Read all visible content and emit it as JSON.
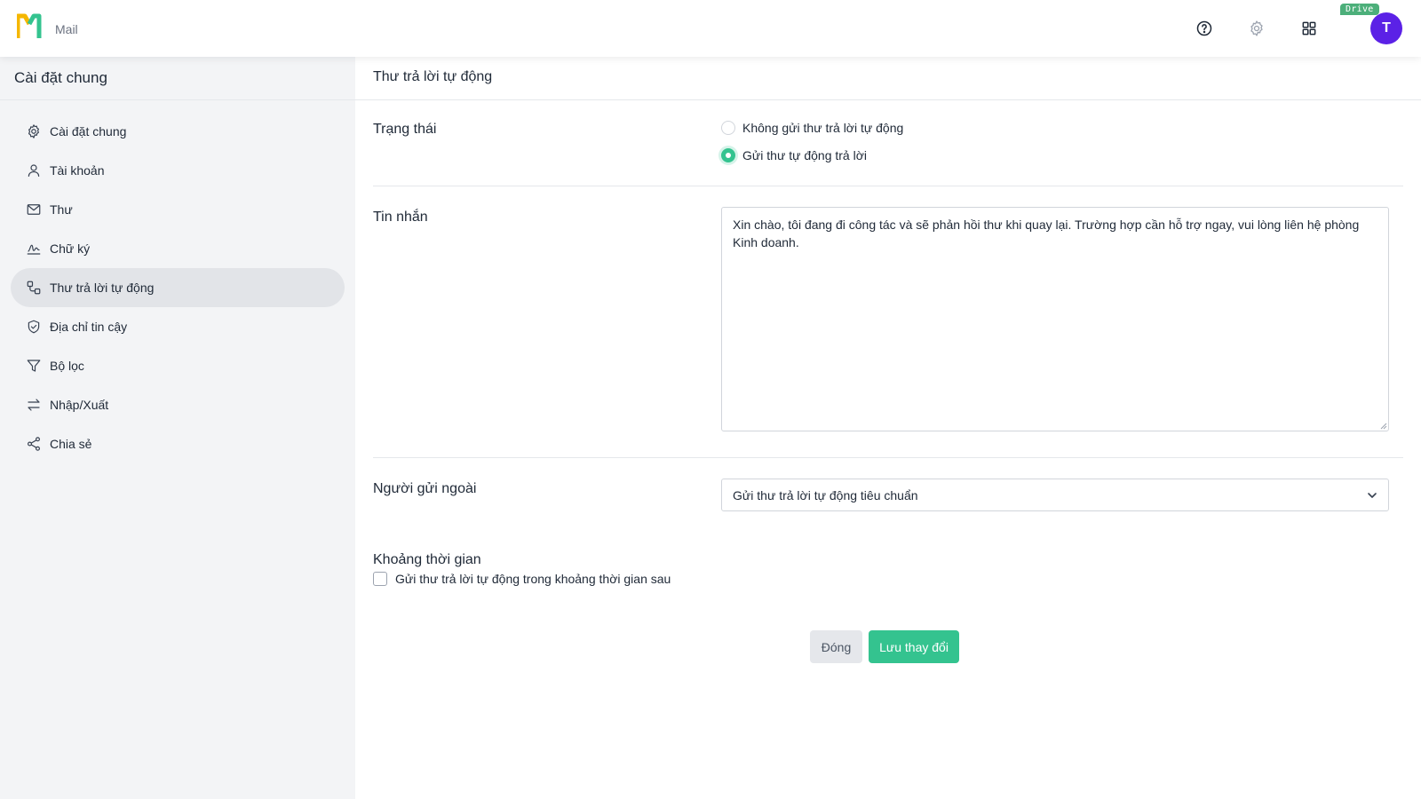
{
  "app": {
    "name": "Mail",
    "drive_badge": "Drive",
    "avatar_initial": "T",
    "brand_color": "#f5b700",
    "accent": "#34c38f",
    "avatar_color": "#5b21e6"
  },
  "header": {
    "icons": [
      "help-circle-icon",
      "gear-icon",
      "apps-grid-icon"
    ]
  },
  "sidebar": {
    "title": "Cài đặt chung",
    "items": [
      {
        "label": "Cài đặt chung",
        "icon": "gear-icon",
        "active": false
      },
      {
        "label": "Tài khoản",
        "icon": "user-icon",
        "active": false
      },
      {
        "label": "Thư",
        "icon": "mail-icon",
        "active": false
      },
      {
        "label": "Chữ ký",
        "icon": "signature-icon",
        "active": false
      },
      {
        "label": "Thư trả lời tự động",
        "icon": "auto-reply-icon",
        "active": true
      },
      {
        "label": "Địa chỉ tin cậy",
        "icon": "shield-check-icon",
        "active": false
      },
      {
        "label": "Bộ lọc",
        "icon": "filter-icon",
        "active": false
      },
      {
        "label": "Nhập/Xuất",
        "icon": "import-export-icon",
        "active": false
      },
      {
        "label": "Chia sẻ",
        "icon": "share-icon",
        "active": false
      }
    ]
  },
  "main": {
    "title": "Thư trả lời tự động",
    "status": {
      "label": "Trạng thái",
      "options": [
        {
          "label": "Không gửi thư trả lời tự động",
          "checked": false
        },
        {
          "label": "Gửi thư tự động trả lời",
          "checked": true
        }
      ]
    },
    "message": {
      "label": "Tin nhắn",
      "value": "Xin chào, tôi đang đi công tác và sẽ phản hồi thư khi quay lại. Trường hợp cần hỗ trợ ngay, vui lòng liên hệ phòng Kinh doanh."
    },
    "external": {
      "label": "Người gửi ngoài",
      "selected": "Gửi thư trả lời tự động tiêu chuẩn"
    },
    "period": {
      "label": "Khoảng thời gian",
      "checkbox_label": "Gửi thư trả lời tự động trong khoảng thời gian sau",
      "checked": false
    },
    "buttons": {
      "close": "Đóng",
      "save": "Lưu thay đổi"
    }
  }
}
